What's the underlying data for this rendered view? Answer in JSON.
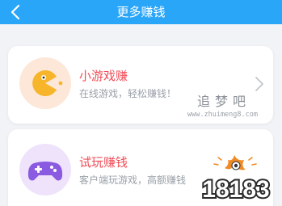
{
  "header": {
    "title": "更多赚钱",
    "bg_color": "#2aa6f9"
  },
  "cards": [
    {
      "title": "小游戏赚",
      "subtitle": "在线游戏，轻松赚钱！",
      "icon": "pacman-icon",
      "title_color": "#f04d57"
    },
    {
      "title": "试玩赚钱",
      "subtitle": "客户端玩游戏，高额赚钱",
      "icon": "gamepad-icon",
      "title_color": "#f04d57"
    }
  ],
  "watermark": {
    "site_name": "追梦吧",
    "url": "www.zhuimeng8.com"
  },
  "logo": {
    "text": "18183"
  }
}
